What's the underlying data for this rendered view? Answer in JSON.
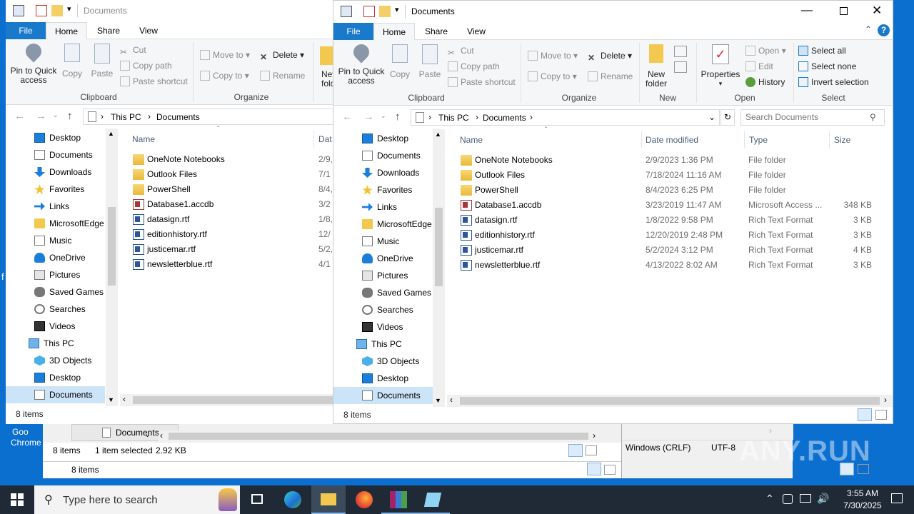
{
  "desktop": {
    "icon_label_1": "Goo",
    "icon_label_2": "Chrome",
    "f_letter": "f"
  },
  "back_window": {
    "title": "Documents",
    "tabs": [
      "File",
      "Home",
      "Share",
      "View"
    ],
    "status_items": "8 items",
    "clipboard_label": "Clipboard",
    "organize_label": "Organize",
    "path": [
      "This PC",
      "Documents"
    ],
    "col_name": "Name",
    "col_date_partial": "Dat",
    "rows_date_partial": [
      "2/9,",
      "7/1",
      "8/4,",
      "3/2",
      "1/8,",
      "12/",
      "5/2,",
      "4/1"
    ]
  },
  "mid_window": {
    "tab_label": "Documents",
    "status_items": "8 items",
    "status_selected": "1 item selected",
    "status_size": "2.92 KB",
    "outer_status": "8 items",
    "partial_8": "8 i"
  },
  "notepad": {
    "line_ending": "Windows (CRLF)",
    "encoding": "UTF-8"
  },
  "front_window": {
    "title": "Documents",
    "tabs": [
      "File",
      "Home",
      "Share",
      "View"
    ],
    "ribbon": {
      "pin_to_quick": "Pin to Quick",
      "access": "access",
      "copy": "Copy",
      "paste": "Paste",
      "cut": "Cut",
      "copy_path": "Copy path",
      "paste_shortcut": "Paste shortcut",
      "clipboard": "Clipboard",
      "move_to": "Move to",
      "copy_to": "Copy to",
      "delete": "Delete",
      "rename": "Rename",
      "organize": "Organize",
      "new_folder_1": "New",
      "new_folder_2": "folder",
      "new": "New",
      "properties": "Properties",
      "open": "Open",
      "edit": "Edit",
      "history": "History",
      "open_group": "Open",
      "select_all": "Select all",
      "select_none": "Select none",
      "invert_selection": "Invert selection",
      "select": "Select"
    },
    "path": [
      "This PC",
      "Documents"
    ],
    "search_placeholder": "Search Documents",
    "columns": [
      "Name",
      "Date modified",
      "Type",
      "Size"
    ],
    "files": [
      {
        "name": "OneNote Notebooks",
        "date": "2/9/2023 1:36 PM",
        "type": "File folder",
        "size": "",
        "kind": "folder"
      },
      {
        "name": "Outlook Files",
        "date": "7/18/2024 11:16 AM",
        "type": "File folder",
        "size": "",
        "kind": "folder"
      },
      {
        "name": "PowerShell",
        "date": "8/4/2023 6:25 PM",
        "type": "File folder",
        "size": "",
        "kind": "folder"
      },
      {
        "name": "Database1.accdb",
        "date": "3/23/2019 11:47 AM",
        "type": "Microsoft Access ...",
        "size": "348 KB",
        "kind": "access"
      },
      {
        "name": "datasign.rtf",
        "date": "1/8/2022 9:58 PM",
        "type": "Rich Text Format",
        "size": "3 KB",
        "kind": "rtf"
      },
      {
        "name": "editionhistory.rtf",
        "date": "12/20/2019 2:48 PM",
        "type": "Rich Text Format",
        "size": "3 KB",
        "kind": "rtf"
      },
      {
        "name": "justicemar.rtf",
        "date": "5/2/2024 3:12 PM",
        "type": "Rich Text Format",
        "size": "4 KB",
        "kind": "rtf"
      },
      {
        "name": "newsletterblue.rtf",
        "date": "4/13/2022 8:02 AM",
        "type": "Rich Text Format",
        "size": "3 KB",
        "kind": "rtf"
      }
    ],
    "status_items": "8 items"
  },
  "nav_items": [
    {
      "label": "Desktop",
      "icon": "desktop-icon"
    },
    {
      "label": "Documents",
      "icon": "documents-icon"
    },
    {
      "label": "Downloads",
      "icon": "downloads-icon"
    },
    {
      "label": "Favorites",
      "icon": "star-icon"
    },
    {
      "label": "Links",
      "icon": "links-icon"
    },
    {
      "label": "MicrosoftEdge",
      "icon": "folder-icon"
    },
    {
      "label": "Music",
      "icon": "music-icon"
    },
    {
      "label": "OneDrive",
      "icon": "onedrive-icon"
    },
    {
      "label": "Pictures",
      "icon": "pictures-icon"
    },
    {
      "label": "Saved Games",
      "icon": "saved-games-icon"
    },
    {
      "label": "Searches",
      "icon": "search-icon"
    },
    {
      "label": "Videos",
      "icon": "videos-icon"
    },
    {
      "label": "This PC",
      "icon": "this-pc-icon"
    },
    {
      "label": "3D Objects",
      "icon": "3d-objects-icon"
    },
    {
      "label": "Desktop",
      "icon": "desktop-icon"
    },
    {
      "label": "Documents",
      "icon": "documents-icon"
    }
  ],
  "taskbar": {
    "search_placeholder": "Type here to search",
    "time": "3:55 AM",
    "date": "7/30/2025"
  },
  "watermark": "ANY.RUN"
}
